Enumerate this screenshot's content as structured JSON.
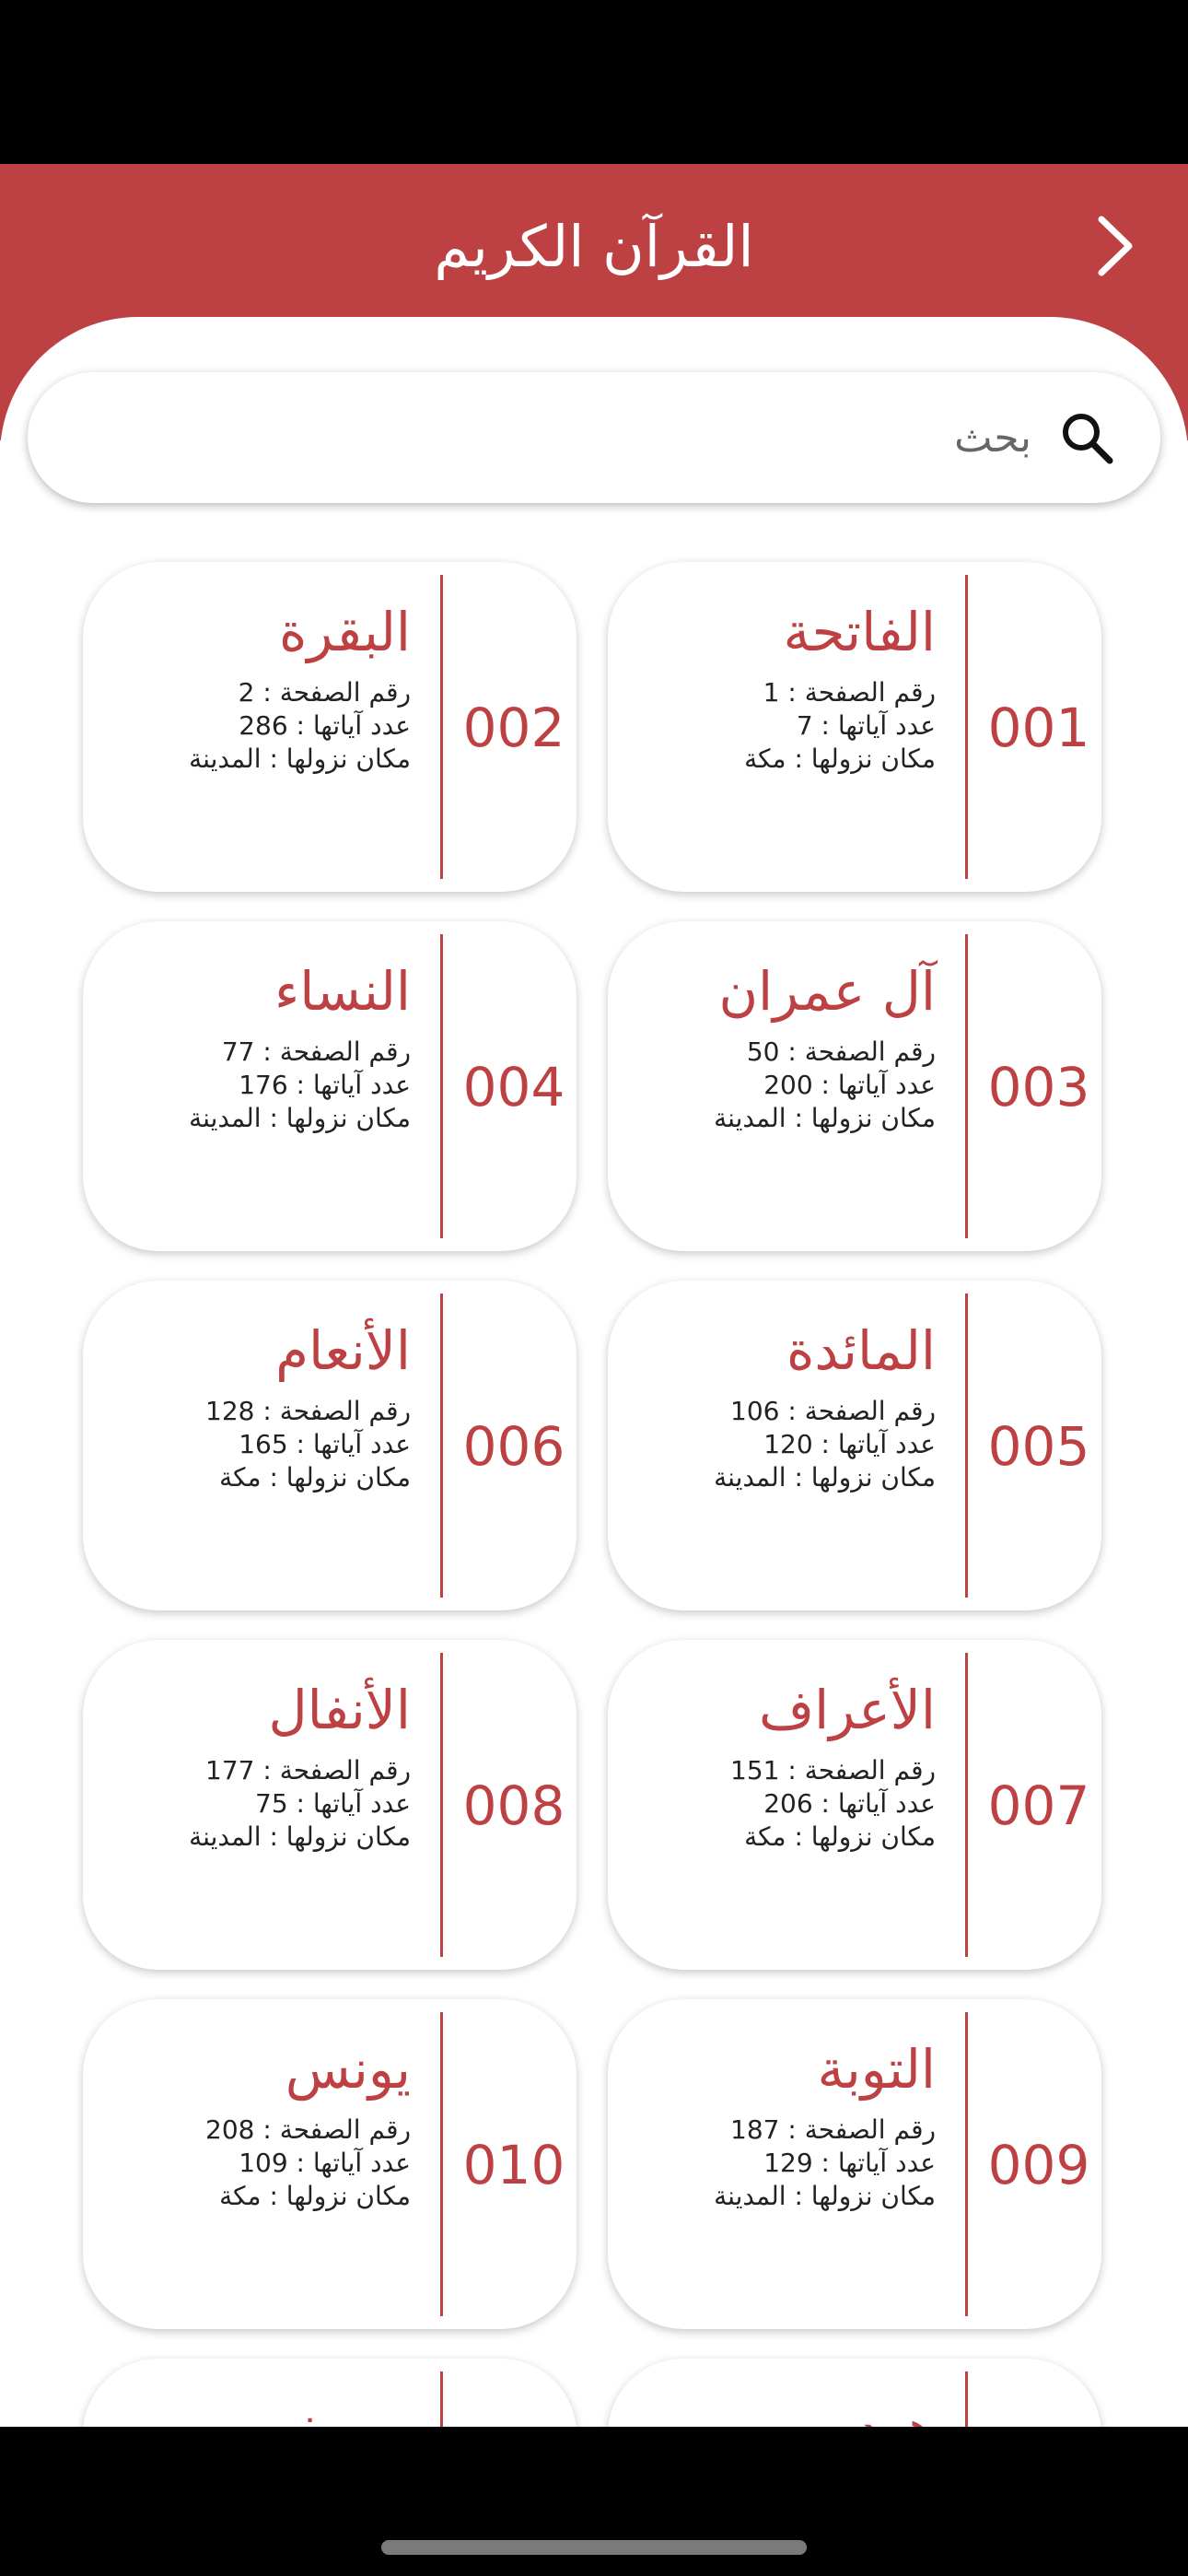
{
  "header": {
    "title": "القرآن الكريم"
  },
  "search": {
    "placeholder": "بحث",
    "value": ""
  },
  "colors": {
    "accent": "#bd4143"
  },
  "icons": {
    "back": "chevron-right-icon",
    "search": "search-icon"
  },
  "labels": {
    "page": "رقم الصفحة :",
    "verses": "عدد آياتها :",
    "place": "مكان نزولها :"
  },
  "surahs": [
    {
      "number": "001",
      "name": "الفاتحة",
      "page": "1",
      "verses": "7",
      "place": "مكة"
    },
    {
      "number": "002",
      "name": "البقرة",
      "page": "2",
      "verses": "286",
      "place": "المدينة"
    },
    {
      "number": "003",
      "name": "آل عمران",
      "page": "50",
      "verses": "200",
      "place": "المدينة"
    },
    {
      "number": "004",
      "name": "النساء",
      "page": "77",
      "verses": "176",
      "place": "المدينة"
    },
    {
      "number": "005",
      "name": "المائدة",
      "page": "106",
      "verses": "120",
      "place": "المدينة"
    },
    {
      "number": "006",
      "name": "الأنعام",
      "page": "128",
      "verses": "165",
      "place": "مكة"
    },
    {
      "number": "007",
      "name": "الأعراف",
      "page": "151",
      "verses": "206",
      "place": "مكة"
    },
    {
      "number": "008",
      "name": "الأنفال",
      "page": "177",
      "verses": "75",
      "place": "المدينة"
    },
    {
      "number": "009",
      "name": "التوبة",
      "page": "187",
      "verses": "129",
      "place": "المدينة"
    },
    {
      "number": "010",
      "name": "يونس",
      "page": "208",
      "verses": "109",
      "place": "مكة"
    },
    {
      "number": "",
      "name": "هود",
      "page": "",
      "verses": "",
      "place": ""
    },
    {
      "number": "",
      "name": "يوسف",
      "page": "",
      "verses": "",
      "place": ""
    }
  ]
}
